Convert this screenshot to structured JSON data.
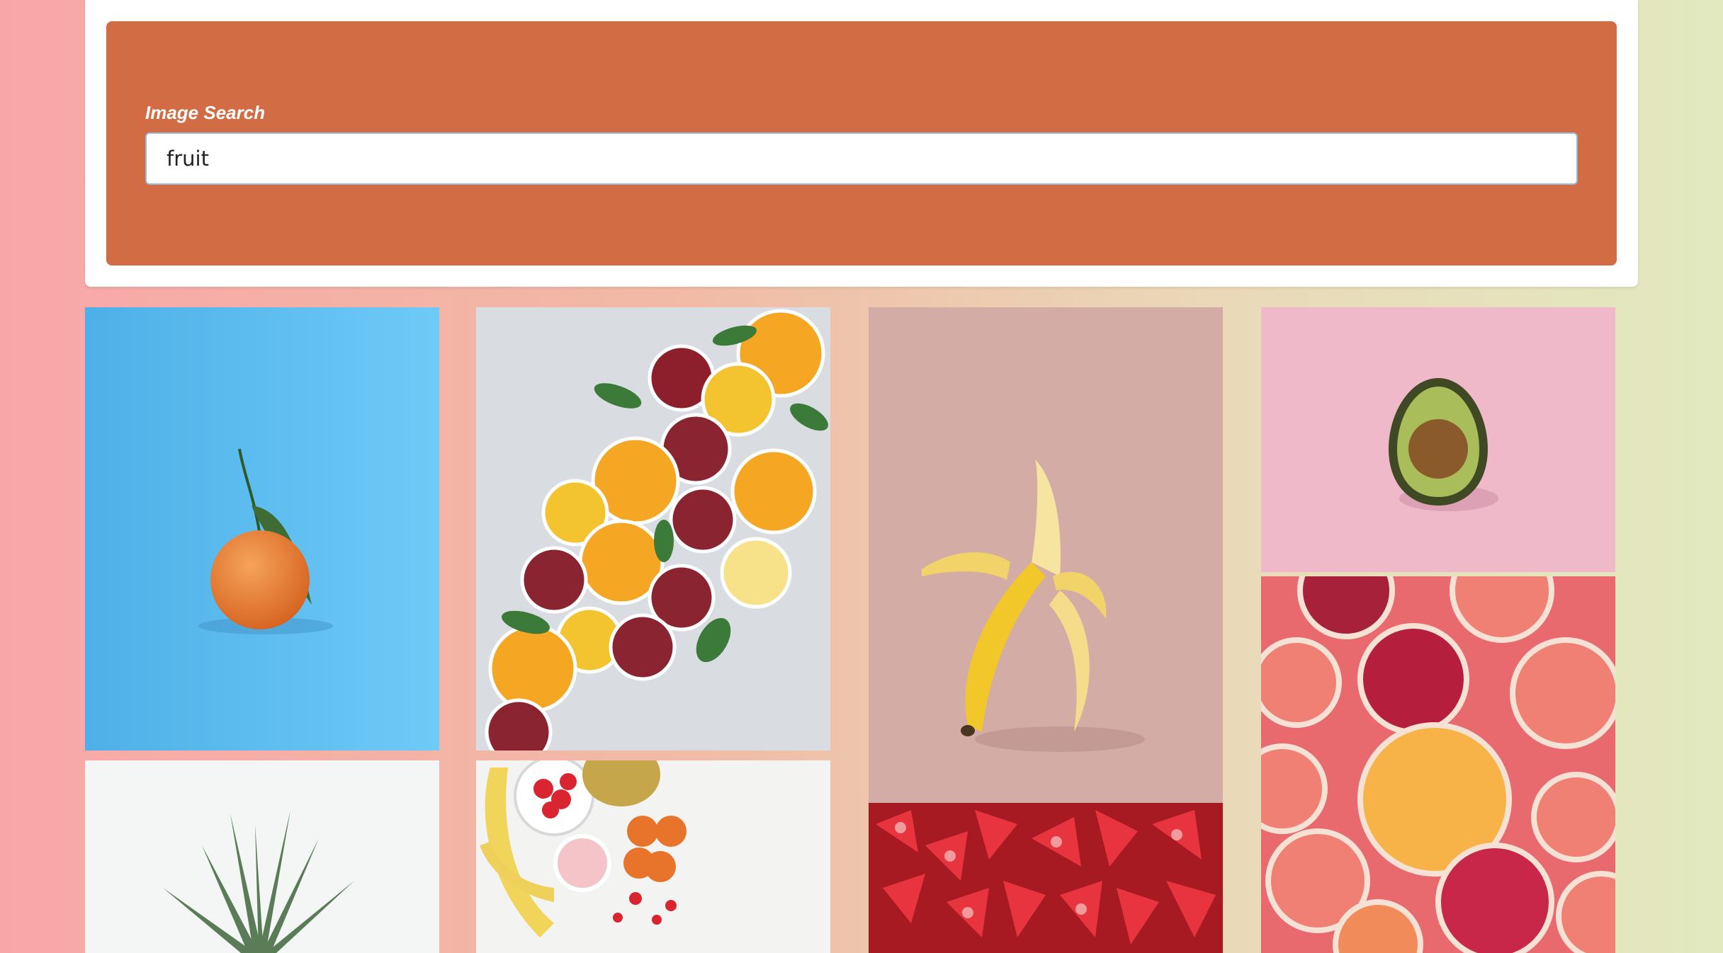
{
  "search": {
    "label": "Image Search",
    "value": "fruit"
  },
  "results": [
    {
      "name": "tangerine-photo",
      "icon": "tangerine-image"
    },
    {
      "name": "citrus-slices-photo",
      "icon": "citrus-slices-image"
    },
    {
      "name": "banana-photo",
      "icon": "banana-image"
    },
    {
      "name": "avocado-photo",
      "icon": "avocado-image"
    },
    {
      "name": "grapefruit-slices-photo",
      "icon": "grapefruit-slices-image"
    },
    {
      "name": "pineapple-photo",
      "icon": "pineapple-image"
    },
    {
      "name": "fruit-flatlay-photo",
      "icon": "fruit-flatlay-image"
    },
    {
      "name": "strawberries-photo",
      "icon": "strawberries-image"
    }
  ],
  "colors": {
    "panel": "#d16c44",
    "card": "#ffffff",
    "input_border": "#9db9d8"
  }
}
